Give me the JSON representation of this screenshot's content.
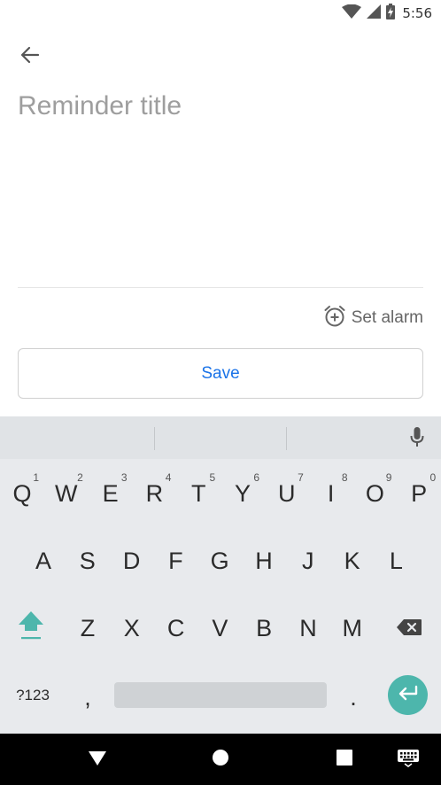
{
  "status_bar": {
    "time": "5:56",
    "icons": [
      "wifi-icon",
      "signal-icon",
      "battery-charging-icon"
    ]
  },
  "header": {
    "back_icon": "arrow-left-icon"
  },
  "form": {
    "title_placeholder": "Reminder title",
    "title_value": "",
    "set_alarm_label": "Set alarm",
    "alarm_icon": "alarm-add-icon",
    "save_label": "Save"
  },
  "keyboard": {
    "row1": [
      {
        "key": "Q",
        "hint": "1"
      },
      {
        "key": "W",
        "hint": "2"
      },
      {
        "key": "E",
        "hint": "3"
      },
      {
        "key": "R",
        "hint": "4"
      },
      {
        "key": "T",
        "hint": "5"
      },
      {
        "key": "Y",
        "hint": "6"
      },
      {
        "key": "U",
        "hint": "7"
      },
      {
        "key": "I",
        "hint": "8"
      },
      {
        "key": "O",
        "hint": "9"
      },
      {
        "key": "P",
        "hint": "0"
      }
    ],
    "row2": [
      "A",
      "S",
      "D",
      "F",
      "G",
      "H",
      "J",
      "K",
      "L"
    ],
    "row3": [
      "Z",
      "X",
      "C",
      "V",
      "B",
      "N",
      "M"
    ],
    "symbols_label": "?123",
    "comma": ",",
    "period": ".",
    "icons": [
      "shift-icon",
      "backspace-icon",
      "microphone-icon",
      "enter-icon"
    ],
    "accent_color": "#4db6ac"
  },
  "nav_bar": {
    "icons": [
      "back-triangle-icon",
      "home-circle-icon",
      "recents-square-icon",
      "keyboard-switch-icon"
    ]
  },
  "colors": {
    "save_text": "#1a73e8",
    "placeholder": "#9e9e9e",
    "keyboard_bg": "#e8eaed"
  }
}
